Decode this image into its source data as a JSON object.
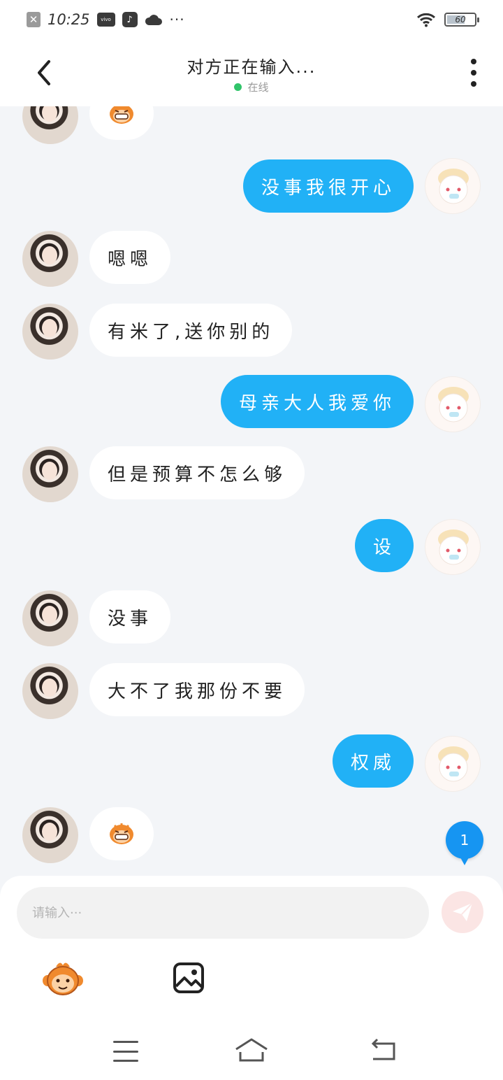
{
  "status_bar": {
    "time": "10:25",
    "battery": "60",
    "more": "···",
    "icons": [
      "close-box-icon",
      "vivo-icon",
      "tiktok-icon",
      "cloud-icon",
      "wifi-icon",
      "battery-icon"
    ]
  },
  "header": {
    "title": "对方正在输入...",
    "status": "在线",
    "status_color": "#31c46a"
  },
  "messages": [
    {
      "side": "left",
      "type": "emoji",
      "icon": "monkey-grin-emoji"
    },
    {
      "side": "right",
      "type": "text",
      "text": "没事我很开心"
    },
    {
      "side": "left",
      "type": "text",
      "text": "嗯嗯"
    },
    {
      "side": "left",
      "type": "text",
      "text": "有米了,送你别的"
    },
    {
      "side": "right",
      "type": "text",
      "text": "母亲大人我爱你"
    },
    {
      "side": "left",
      "type": "text",
      "text": "但是预算不怎么够"
    },
    {
      "side": "right",
      "type": "text",
      "text": "设"
    },
    {
      "side": "left",
      "type": "text",
      "text": "没事"
    },
    {
      "side": "left",
      "type": "text",
      "text": "大不了我那份不要"
    },
    {
      "side": "right",
      "type": "text",
      "text": "权威"
    },
    {
      "side": "left",
      "type": "emoji",
      "icon": "monkey-grin-emoji"
    }
  ],
  "unread_badge": "1",
  "input": {
    "placeholder": "请输入···",
    "value": ""
  },
  "toolbar": {
    "emoji_icon": "monkey-emoji-icon",
    "image_icon": "image-icon"
  },
  "colors": {
    "accent": "#21b1f6",
    "background": "#f3f5f8",
    "send_button": "#fbe5e4",
    "badge": "#1695f2"
  }
}
